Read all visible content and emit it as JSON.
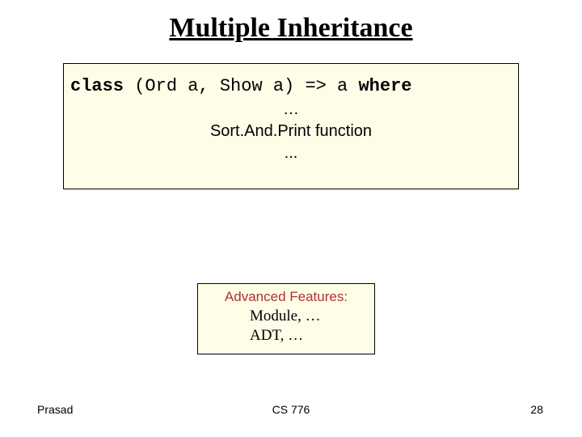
{
  "title": "Multiple Inheritance",
  "code": {
    "kw1": "class",
    "mid": " (Ord a, Show a) => a ",
    "kw2": "where",
    "ellipsis1": "…",
    "func": "Sort.And.Print function",
    "ellipsis2": "..."
  },
  "features": {
    "heading": "Advanced Features:",
    "items": [
      "Module, …",
      "ADT, …"
    ]
  },
  "footer": {
    "left": "Prasad",
    "center": "CS 776",
    "right": "28"
  }
}
